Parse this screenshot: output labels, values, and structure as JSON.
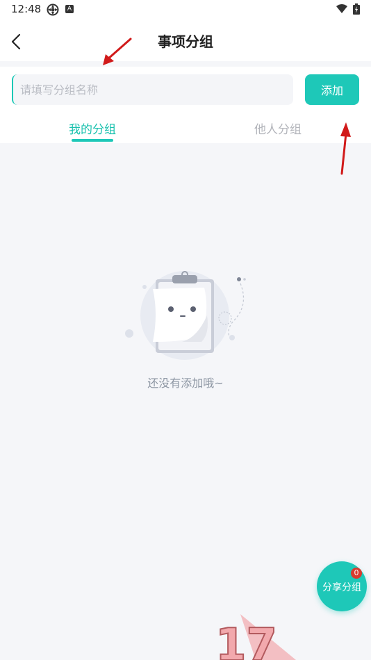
{
  "status_bar": {
    "time": "12:48",
    "icons": [
      "settings-pinwheel-icon",
      "a-badge-icon",
      "wifi-icon",
      "battery-icon"
    ],
    "badge_letter": "A"
  },
  "header": {
    "title": "事项分组",
    "back_icon": "chevron-left-icon"
  },
  "group_form": {
    "placeholder": "请填写分组名称",
    "value": "",
    "add_label": "添加"
  },
  "tabs": [
    {
      "label": "我的分组",
      "active": true
    },
    {
      "label": "他人分组",
      "active": false
    }
  ],
  "empty_state": {
    "icon": "clipboard-face-icon",
    "text": "还没有添加哦~"
  },
  "share_button": {
    "label": "分享分组",
    "badge": "0"
  },
  "colors": {
    "accent": "#1ec8b8",
    "tab_active": "#19c1ae",
    "tab_inactive": "#b3b5bb",
    "background": "#f5f6f9",
    "badge": "#d93a2f",
    "annotation_arrow": "#d11a1a"
  },
  "watermark": {
    "text": "17"
  }
}
